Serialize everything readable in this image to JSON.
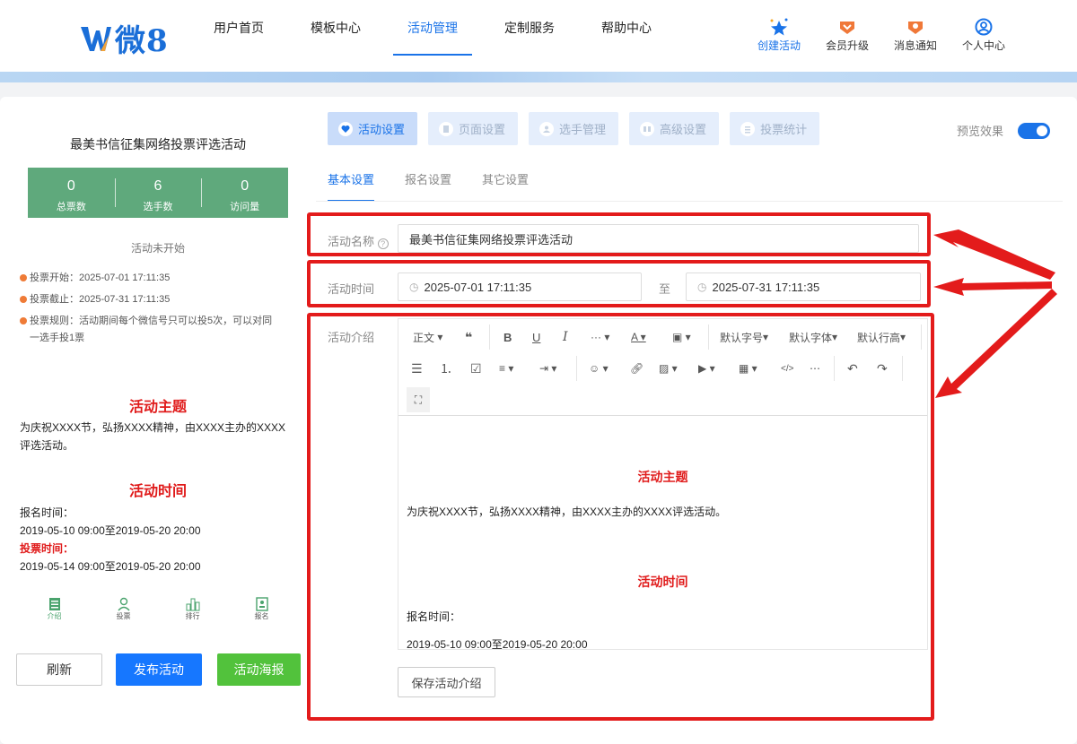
{
  "brand": {
    "logo_text": "微8"
  },
  "nav": [
    "用户首页",
    "模板中心",
    "活动管理",
    "定制服务",
    "帮助中心"
  ],
  "top_actions": [
    "创建活动",
    "会员升级",
    "消息通知",
    "个人中心"
  ],
  "left_panel": {
    "title": "最美书信征集网络投票评选活动",
    "stats": [
      {
        "value": "0",
        "label": "总票数"
      },
      {
        "value": "6",
        "label": "选手数"
      },
      {
        "value": "0",
        "label": "访问量"
      }
    ],
    "status": "活动未开始",
    "vote_start": "投票开始：2025-07-01 17:11:35",
    "vote_end": "投票截止：2025-07-31 17:11:35",
    "vote_rule": "投票规则：活动期间每个微信号只可以投5次，可以对同一选手投1票"
  },
  "preview": {
    "theme_heading": "活动主题",
    "theme_text": "为庆祝XXXX节，弘扬XXXX精神，由XXXX主办的XXXX评选活动。",
    "time_heading": "活动时间",
    "signup_label": "报名时间：",
    "signup_range": "2019-05-10 09:00至2019-05-20 20:00",
    "vote_label": "投票时间：",
    "vote_range": "2019-05-14 09:00至2019-05-20 20:00"
  },
  "mobile_tabs": [
    "介绍",
    "投票",
    "排行",
    "报名"
  ],
  "left_buttons": {
    "refresh": "刷新",
    "publish": "发布活动",
    "poster": "活动海报"
  },
  "settings_tabs": [
    "活动设置",
    "页面设置",
    "选手管理",
    "高级设置",
    "投票统计"
  ],
  "preview_toggle": {
    "label": "预览效果",
    "on": true
  },
  "sub_tabs": [
    "基本设置",
    "报名设置",
    "其它设置"
  ],
  "form": {
    "name_label": "活动名称",
    "name_value": "最美书信征集网络投票评选活动",
    "time_label": "活动时间",
    "time_start": "2025-07-01 17:11:35",
    "time_sep": "至",
    "time_end": "2025-07-31 17:11:35",
    "intro_label": "活动介绍",
    "save_button": "保存活动介绍"
  },
  "editor_toolbar": {
    "paragraph": "正文",
    "font_size": "默认字号",
    "font_family": "默认字体",
    "line_height": "默认行高"
  },
  "editor_content": {
    "theme_heading": "活动主题",
    "theme_text": "为庆祝XXXX节，弘扬XXXX精神，由XXXX主办的XXXX评选活动。",
    "time_heading": "活动时间",
    "signup_label": "报名时间：",
    "signup_range": "2019-05-10 09:00至2019-05-20 20:00"
  },
  "colors": {
    "accent": "#1a73e8",
    "stats_bg": "#5fa97c",
    "highlight": "#e31b1b",
    "heading_red": "#e01b1b",
    "poster_btn": "#52c23c"
  }
}
